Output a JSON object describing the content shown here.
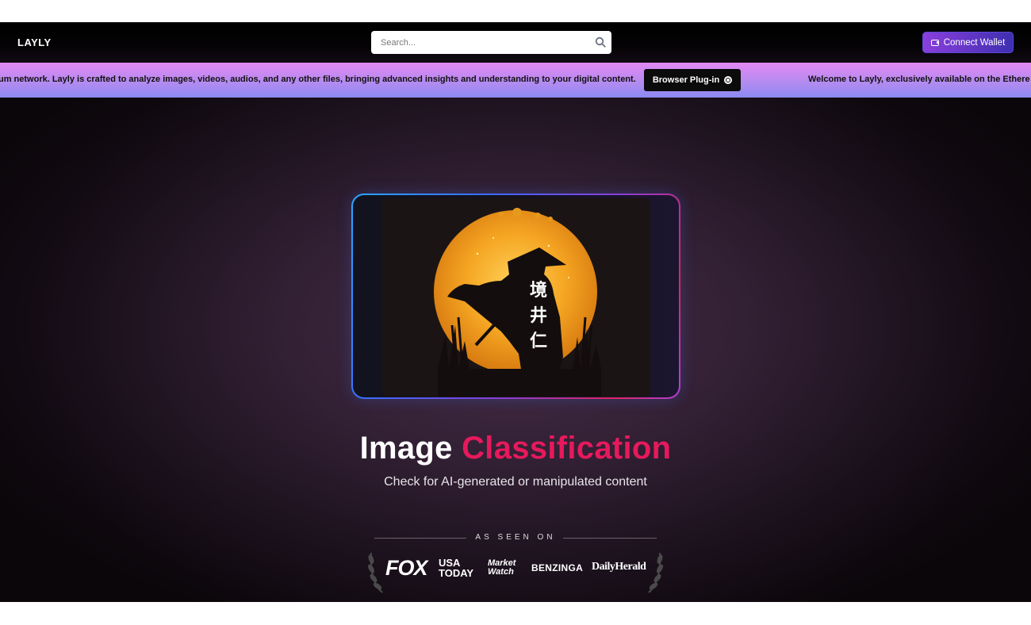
{
  "header": {
    "logo": "LAYLY",
    "search_placeholder": "Search...",
    "connect_wallet_label": "Connect Wallet"
  },
  "marquee": {
    "text_left": "um network. Layly is crafted to analyze images, videos, audios, and any other files, bringing advanced insights and understanding to your digital content.",
    "plugin_label": "Browser Plug-in",
    "text_right": "Welcome to Layly, exclusively available on the Ethere"
  },
  "hero": {
    "title_main": "Image",
    "title_accent": "Classification",
    "subtitle": "Check for AI-generated or manipulated content",
    "seen_on": "AS SEEN ON",
    "artwork_glyphs": [
      "境",
      "井",
      "仁"
    ]
  },
  "press": {
    "fox": "FOX",
    "usa_today_line1": "USA",
    "usa_today_line2": "TODAY",
    "market_watch_line1": "Market",
    "market_watch_line2": "Watch",
    "benzinga": "BENZINGA",
    "daily_herald": "DailyHerald"
  },
  "colors": {
    "accent": "#e6195c",
    "wallet_start": "#8b3fdc",
    "wallet_end": "#3d2fb0",
    "marquee_top": "#e389f3",
    "marquee_bottom": "#8b8af2"
  }
}
